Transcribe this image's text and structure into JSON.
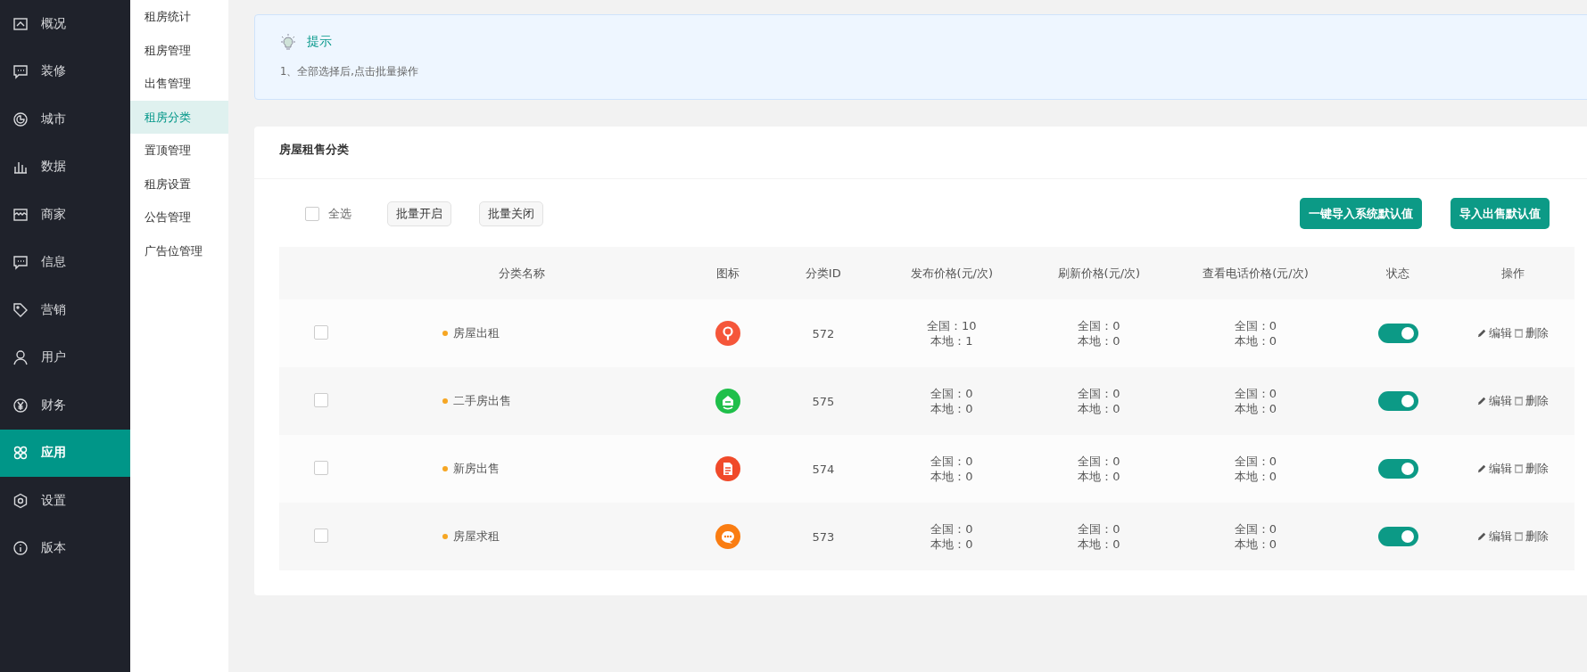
{
  "sidebar": {
    "items": [
      {
        "label": "概况",
        "selected": false
      },
      {
        "label": "装修",
        "selected": false
      },
      {
        "label": "城市",
        "selected": false
      },
      {
        "label": "数据",
        "selected": false
      },
      {
        "label": "商家",
        "selected": false
      },
      {
        "label": "信息",
        "selected": false
      },
      {
        "label": "营销",
        "selected": false
      },
      {
        "label": "用户",
        "selected": false
      },
      {
        "label": "财务",
        "selected": false
      },
      {
        "label": "应用",
        "selected": true
      },
      {
        "label": "设置",
        "selected": false
      },
      {
        "label": "版本",
        "selected": false
      }
    ]
  },
  "submenu": {
    "items": [
      {
        "label": "租房统计",
        "selected": false
      },
      {
        "label": "租房管理",
        "selected": false
      },
      {
        "label": "出售管理",
        "selected": false
      },
      {
        "label": "租房分类",
        "selected": true
      },
      {
        "label": "置顶管理",
        "selected": false
      },
      {
        "label": "租房设置",
        "selected": false
      },
      {
        "label": "公告管理",
        "selected": false
      },
      {
        "label": "广告位管理",
        "selected": false
      }
    ]
  },
  "tip": {
    "title": "提示",
    "lines": [
      "1、全部选择后,点击批量操作"
    ]
  },
  "card": {
    "title": "房屋租售分类",
    "select_all": {
      "label": "全选",
      "checked": false
    },
    "batch_buttons": [
      "批量开启",
      "批量关闭"
    ],
    "import_buttons": [
      "一键导入系统默认值",
      "导入出售默认值"
    ],
    "table": {
      "columns": [
        "分类名称",
        "图标",
        "分类ID",
        "发布价格(元/次)",
        "刷新价格(元/次)",
        "查看电话价格(元/次)",
        "状态",
        "操作"
      ],
      "rows": [
        {
          "checked": false,
          "name": "房屋出租",
          "icon": {
            "kind": "pin",
            "color": "#f5563a"
          },
          "id": "572",
          "publish": [
            "全国：10",
            "本地：1"
          ],
          "refresh": [
            "全国：0",
            "本地：0"
          ],
          "phone": [
            "全国：0",
            "本地：0"
          ],
          "on": true,
          "actions": [
            "编辑",
            "删除"
          ]
        },
        {
          "checked": false,
          "name": "二手房出售",
          "icon": {
            "kind": "house",
            "color": "#1fbf4a"
          },
          "id": "575",
          "publish": [
            "全国：0",
            "本地：0"
          ],
          "refresh": [
            "全国：0",
            "本地：0"
          ],
          "phone": [
            "全国：0",
            "本地：0"
          ],
          "on": true,
          "actions": [
            "编辑",
            "删除"
          ]
        },
        {
          "checked": false,
          "name": "新房出售",
          "icon": {
            "kind": "doc",
            "color": "#f04a2a"
          },
          "id": "574",
          "publish": [
            "全国：0",
            "本地：0"
          ],
          "refresh": [
            "全国：0",
            "本地：0"
          ],
          "phone": [
            "全国：0",
            "本地：0"
          ],
          "on": true,
          "actions": [
            "编辑",
            "删除"
          ]
        },
        {
          "checked": false,
          "name": "房屋求租",
          "icon": {
            "kind": "chat",
            "color": "#fa7d12"
          },
          "id": "573",
          "publish": [
            "全国：0",
            "本地：0"
          ],
          "refresh": [
            "全国：0",
            "本地：0"
          ],
          "phone": [
            "全国：0",
            "本地：0"
          ],
          "on": true,
          "actions": [
            "编辑",
            "删除"
          ]
        }
      ]
    }
  }
}
